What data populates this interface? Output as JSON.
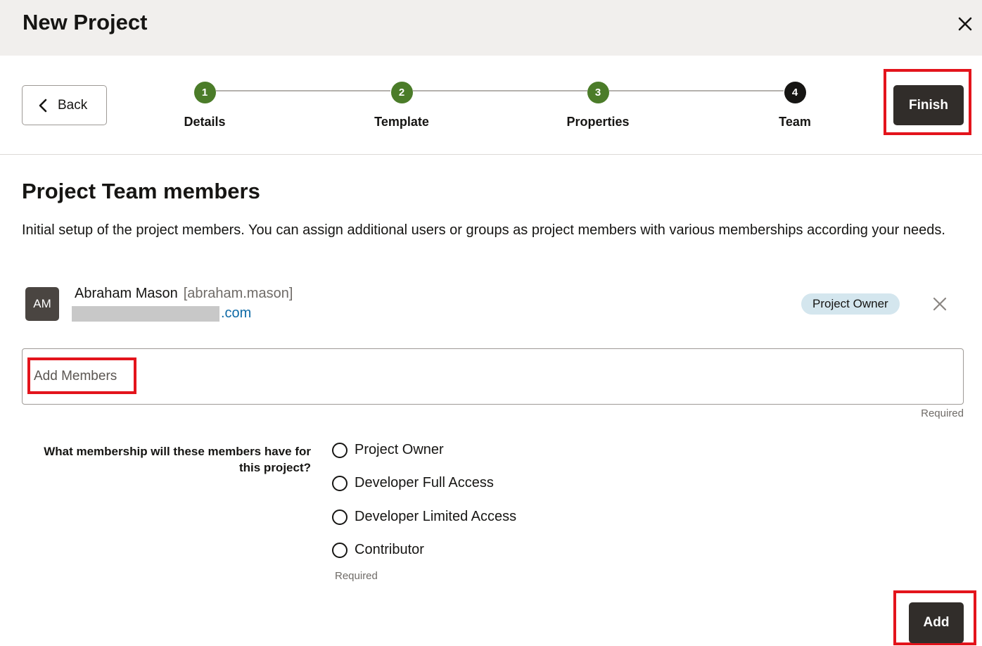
{
  "dialog": {
    "title": "New Project",
    "close_icon": "close-icon"
  },
  "nav": {
    "back_label": "Back",
    "back_icon": "chevron-left-icon",
    "finish_label": "Finish"
  },
  "steps": [
    {
      "number": "1",
      "label": "Details",
      "status": "complete"
    },
    {
      "number": "2",
      "label": "Template",
      "status": "complete"
    },
    {
      "number": "3",
      "label": "Properties",
      "status": "complete"
    },
    {
      "number": "4",
      "label": "Team",
      "status": "current"
    }
  ],
  "section": {
    "title": "Project Team members",
    "description": "Initial setup of the project members. You can assign additional users or groups as project members with various memberships according your needs."
  },
  "members": [
    {
      "initials": "AM",
      "name": "Abraham Mason",
      "username": "[abraham.mason]",
      "email_visible": ".com",
      "role": "Project Owner"
    }
  ],
  "add_members": {
    "placeholder": "Add Members",
    "required_label": "Required"
  },
  "membership": {
    "question": "What membership will these members have for this project?",
    "options": [
      "Project Owner",
      "Developer Full Access",
      "Developer Limited Access",
      "Contributor"
    ],
    "selected": null,
    "required_label": "Required"
  },
  "actions": {
    "add_label": "Add"
  },
  "colors": {
    "header_bg": "#f1efed",
    "step_complete": "#4b7c29",
    "step_current": "#161513",
    "primary_button": "#312d2a",
    "highlight": "#e3141c",
    "badge_bg": "#d4e6ee",
    "link": "#0e6aa6"
  }
}
